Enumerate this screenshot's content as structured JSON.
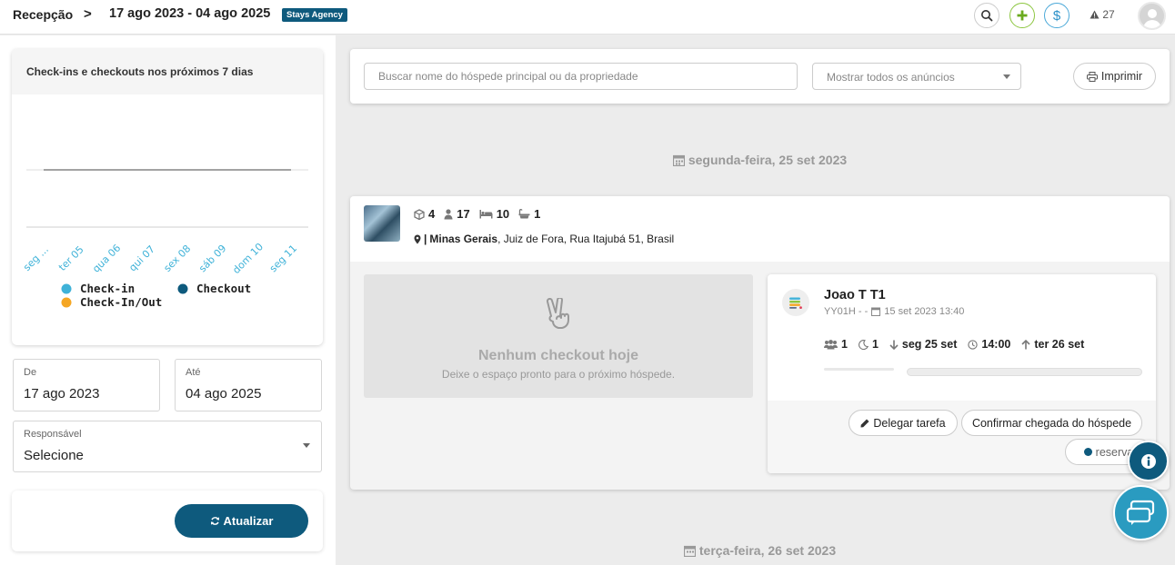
{
  "header": {
    "title": "Recepção",
    "separator": ">",
    "date_range": "17 ago 2023 - 04 ago 2025",
    "agency_badge": "Stays Agency",
    "alerts_count": "27"
  },
  "sidebar": {
    "chart_title": "Check-ins e checkouts nos próximos 7 dias",
    "date_from": {
      "label": "De",
      "value": "17 ago 2023"
    },
    "date_to": {
      "label": "Até",
      "value": "04 ago 2025"
    },
    "responsible": {
      "label": "Responsável",
      "value": "Selecione"
    },
    "refresh_label": "Atualizar"
  },
  "chart_data": {
    "type": "line",
    "categories": [
      "seg ...",
      "ter 05",
      "qua 06",
      "qui 07",
      "sex 08",
      "sáb 09",
      "dom 10",
      "seg 11"
    ],
    "series": [
      {
        "name": "Check-in",
        "color": "#3fb2d8",
        "values": [
          0,
          0,
          0,
          0,
          0,
          0,
          0,
          0
        ]
      },
      {
        "name": "Checkout",
        "color": "#0e5a7d",
        "values": [
          0,
          0,
          0,
          0,
          0,
          0,
          0,
          0
        ]
      },
      {
        "name": "Check-In/Out",
        "color": "#f5a623",
        "values": [
          0,
          0,
          0,
          0,
          0,
          0,
          0,
          0
        ]
      }
    ],
    "title": "Check-ins e checkouts nos próximos 7 dias",
    "xlabel": "",
    "ylabel": "",
    "grid": true,
    "legend": "bottom"
  },
  "filters": {
    "search_placeholder": "Buscar nome do hóspede principal ou da propriedade",
    "listing_select": "Mostrar todos os anúncios",
    "print_label": "Imprimir"
  },
  "days": [
    {
      "label": "segunda-feira, 25 set 2023",
      "property": {
        "units": "4",
        "guests": "17",
        "beds": "10",
        "baths": "1",
        "address_prefix": "|",
        "address_region": "Minas Gerais",
        "address_rest": ", Juiz de Fora, Rua Itajubá 51, Brasil"
      },
      "empty_checkout": {
        "title": "Nenhum checkout hoje",
        "subtitle": "Deixe o espaço pronto para o próximo hóspede."
      },
      "reservation": {
        "guest": "Joao T T1",
        "code": "YY01H - -",
        "created": "15 set 2023 13:40",
        "guests": "1",
        "nights": "1",
        "checkin": "seg 25 set",
        "time": "14:00",
        "checkout": "ter 26 set",
        "delegate_label": "Delegar tarefa",
        "confirm_label": "Confirmar chegada do hóspede",
        "reserva_label": "reserva"
      }
    },
    {
      "label": "terça-feira, 26 set 2023"
    }
  ],
  "colors": {
    "brand": "#0e5a7d",
    "accent_green": "#8cc63f",
    "accent_blue": "#4aa8d8"
  }
}
